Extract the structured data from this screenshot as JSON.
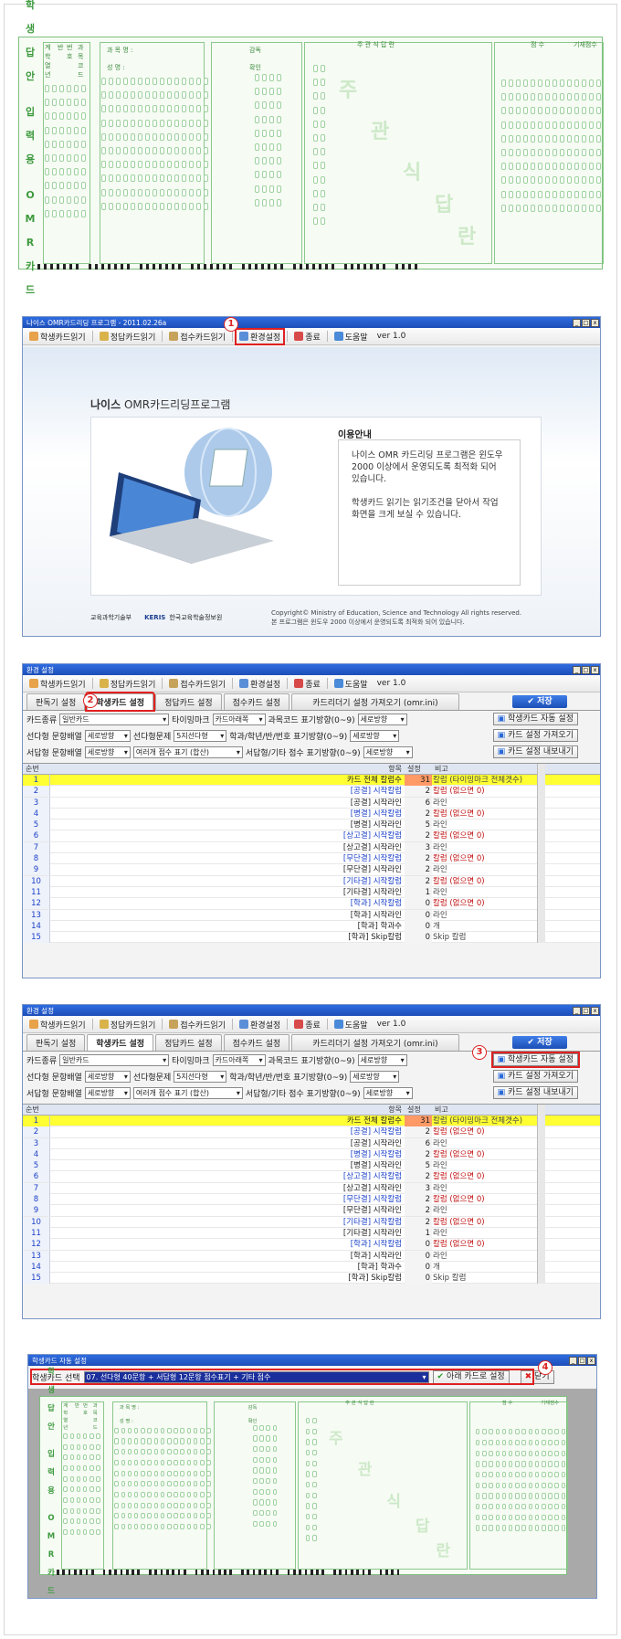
{
  "omr": {
    "vertical_label": [
      "학",
      "생",
      "답",
      "안",
      "",
      "입",
      "력",
      "용",
      "",
      "O",
      "M",
      "R",
      "카",
      "드"
    ],
    "col_headers": [
      "계학 열년",
      "반",
      "번호",
      "과목 코드"
    ],
    "subject_label": "과 목 명 :",
    "name_label": "성 명 :",
    "check_label": "감독",
    "confirm_label": "확인",
    "subjective_header": "주 관 식 답 란",
    "ghost": [
      "주",
      "관",
      "식",
      "답",
      "란"
    ],
    "score_header": "점 수",
    "total_label": "기재점수"
  },
  "window1": {
    "title": "나이스 OMR카드리딩 프로그램 - 2011.02.26a",
    "toolbar": [
      "학생카드읽기",
      "정답카드읽기",
      "접수카드읽기",
      "환경설정",
      "종료",
      "도움말",
      "ver 1.0"
    ],
    "heading_bold": "나이스",
    "heading_rest": " OMR카드리딩프로그램",
    "notice_title": "이용안내",
    "notice_p1": "나이스 OMR 카드리딩 프로그램은 윈도우 2000 이상에서 운영되도록 최적화 되어 있습니다.",
    "notice_p2": "학생카드 읽기는 읽기조건을 닫아서 작업 화면을 크게 보실 수 있습니다.",
    "footer_logo1": "교육과학기술부",
    "footer_logo2": "KERIS",
    "footer_logo2_sub": "한국교육학술정보원",
    "copyright": "Copyright© Ministry of Education, Science and Technology All rights reserved.",
    "footer_note": "본 프로그램은 윈도우 2000 이상에서 운영되도록 최적화 되어 있습니다."
  },
  "settings": {
    "title": "환경 설정",
    "toolbar": [
      "학생카드읽기",
      "정답카드읽기",
      "접수카드읽기",
      "환경설정",
      "종료",
      "도움말",
      "ver 1.0"
    ],
    "tabs": [
      "판독기 설정",
      "학생카드 설정",
      "정답카드 설정",
      "점수카드 설정",
      "카드리더기 설정 가져오기 (omr.ini)"
    ],
    "save": "저장",
    "row1": {
      "l1": "카드종류",
      "v1": "일반카드",
      "l2": "타이밍마크",
      "v2": "카드아래쪽",
      "l3": "과목코드 표기방향(0~9)",
      "v3": "세로방향",
      "btn": "학생카드 자동 설정"
    },
    "row2": {
      "l1": "선다형 문항배열",
      "v1": "세로방향",
      "l2": "선다형문제",
      "v2": "5지선다형",
      "l3": "학과/학년/반/번호 표기방향(0~9)",
      "v3": "세로방향",
      "btn": "카드 설정 가져오기"
    },
    "row3": {
      "l1": "서답형 문항배열",
      "v1": "세로방향",
      "v1b": "여러개 점수 표기 (합산)",
      "l3": "서답형/기타 점수 표기방향(0~9)",
      "v3": "세로방향",
      "btn": "카드 설정 내보내기"
    },
    "cols": [
      "순번",
      "항목",
      "설정",
      "비고"
    ],
    "rows": [
      {
        "n": "1",
        "item": "카드 전체 칼럼수",
        "val": "31",
        "memo": "칼럼 (타이밍마크 전체갯수)",
        "hl": true
      },
      {
        "n": "2",
        "item": "[공결] 시작칼럼",
        "val": "2",
        "memo": "칼럼 (없으면 0)",
        "blue": true
      },
      {
        "n": "3",
        "item": "[공결] 시작라인",
        "val": "6",
        "memo": "라인"
      },
      {
        "n": "4",
        "item": "[병결] 시작칼럼",
        "val": "2",
        "memo": "칼럼 (없으면 0)",
        "blue": true
      },
      {
        "n": "5",
        "item": "[병결] 시작라인",
        "val": "5",
        "memo": "라인"
      },
      {
        "n": "6",
        "item": "[상고결] 시작칼럼",
        "val": "2",
        "memo": "칼럼 (없으면 0)",
        "blue": true
      },
      {
        "n": "7",
        "item": "[상고결] 시작라인",
        "val": "3",
        "memo": "라인"
      },
      {
        "n": "8",
        "item": "[무단결] 시작칼럼",
        "val": "2",
        "memo": "칼럼 (없으면 0)",
        "blue": true
      },
      {
        "n": "9",
        "item": "[무단결] 시작라인",
        "val": "2",
        "memo": "라인"
      },
      {
        "n": "10",
        "item": "[기타결] 시작칼럼",
        "val": "2",
        "memo": "칼럼 (없으면 0)",
        "blue": true
      },
      {
        "n": "11",
        "item": "[기타결] 시작라인",
        "val": "1",
        "memo": "라인"
      },
      {
        "n": "12",
        "item": "[학과] 시작칼럼",
        "val": "0",
        "memo": "칼럼 (없으면 0)",
        "blue": true
      },
      {
        "n": "13",
        "item": "[학과] 시작라인",
        "val": "0",
        "memo": "라인"
      },
      {
        "n": "14",
        "item": "[학과] 학과수",
        "val": "0",
        "memo": "개"
      },
      {
        "n": "15",
        "item": "[학과] Skip칼럼",
        "val": "0",
        "memo": "Skip 칼럼"
      }
    ]
  },
  "autoset": {
    "title": "학생카드 자동 설정",
    "select_label": "학생카드 선택",
    "select_value": "07. 선다형 40문항 + 서답형 12문항 점수표기 + 기타 점수",
    "apply": "아래 카드로 설정",
    "close": "닫기"
  },
  "badges": [
    "1",
    "2",
    "3",
    "4"
  ]
}
